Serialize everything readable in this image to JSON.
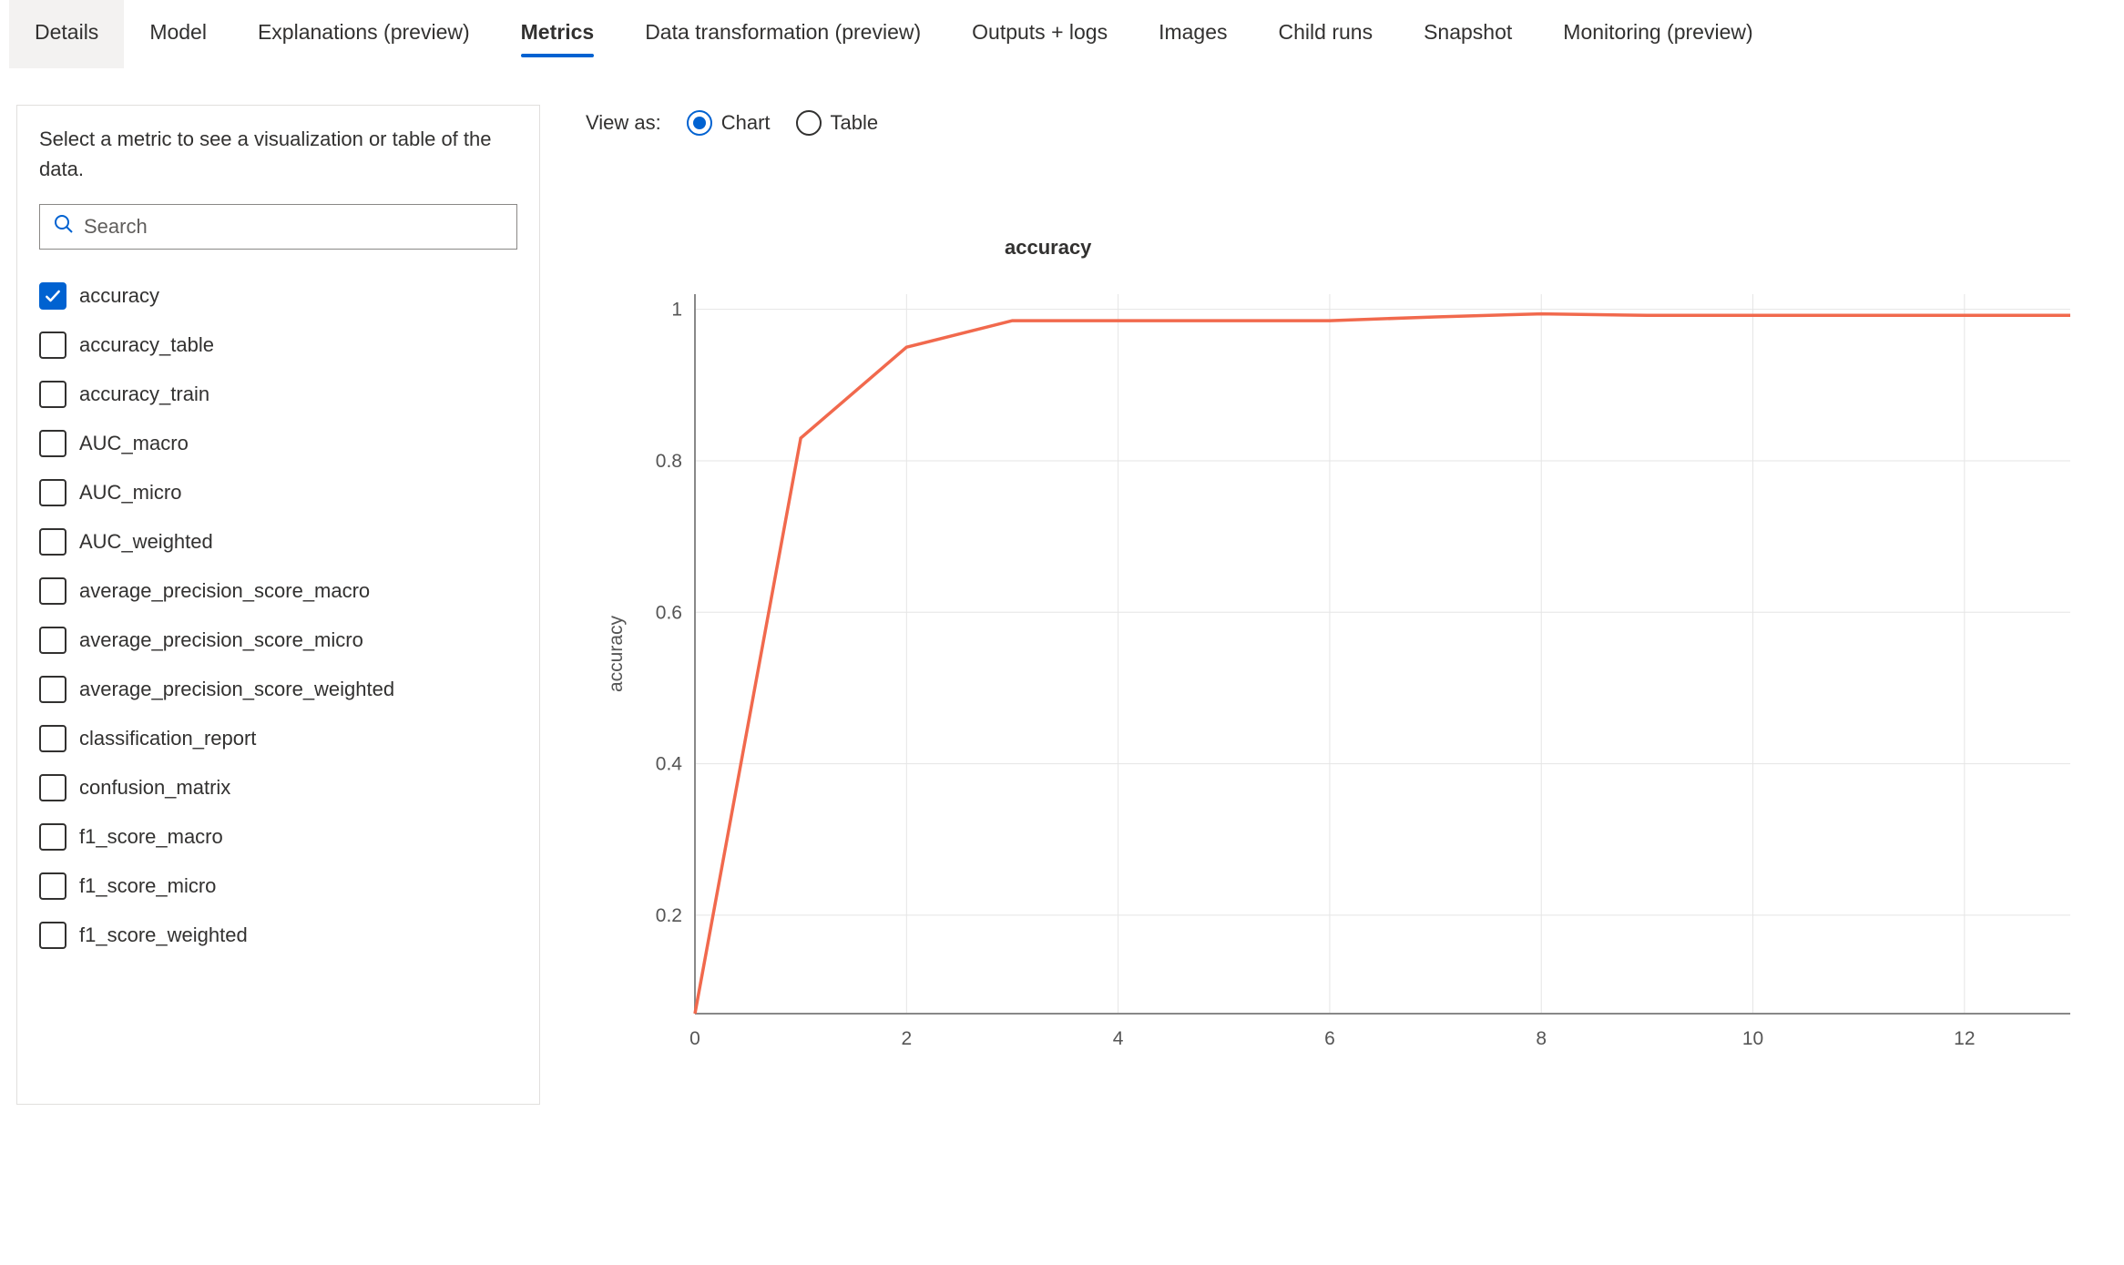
{
  "tabs": [
    {
      "label": "Details",
      "state": "bg"
    },
    {
      "label": "Model",
      "state": ""
    },
    {
      "label": "Explanations (preview)",
      "state": ""
    },
    {
      "label": "Metrics",
      "state": "current"
    },
    {
      "label": "Data transformation (preview)",
      "state": ""
    },
    {
      "label": "Outputs + logs",
      "state": ""
    },
    {
      "label": "Images",
      "state": ""
    },
    {
      "label": "Child runs",
      "state": ""
    },
    {
      "label": "Snapshot",
      "state": ""
    },
    {
      "label": "Monitoring (preview)",
      "state": ""
    }
  ],
  "sidebar": {
    "header": "Select a metric to see a visualization or table of the data.",
    "search_placeholder": "Search"
  },
  "metrics": [
    {
      "label": "accuracy",
      "checked": true
    },
    {
      "label": "accuracy_table",
      "checked": false
    },
    {
      "label": "accuracy_train",
      "checked": false
    },
    {
      "label": "AUC_macro",
      "checked": false
    },
    {
      "label": "AUC_micro",
      "checked": false
    },
    {
      "label": "AUC_weighted",
      "checked": false
    },
    {
      "label": "average_precision_score_macro",
      "checked": false
    },
    {
      "label": "average_precision_score_micro",
      "checked": false
    },
    {
      "label": "average_precision_score_weighted",
      "checked": false
    },
    {
      "label": "classification_report",
      "checked": false
    },
    {
      "label": "confusion_matrix",
      "checked": false
    },
    {
      "label": "f1_score_macro",
      "checked": false
    },
    {
      "label": "f1_score_micro",
      "checked": false
    },
    {
      "label": "f1_score_weighted",
      "checked": false
    }
  ],
  "view_as": {
    "label": "View as:",
    "option_chart": "Chart",
    "option_table": "Table",
    "selected": "chart"
  },
  "chart_data": {
    "type": "line",
    "title": "accuracy",
    "xlabel": "",
    "ylabel": "accuracy",
    "xlim": [
      0,
      13
    ],
    "ylim": [
      0.07,
      1.02
    ],
    "x": [
      0,
      1,
      2,
      3,
      4,
      5,
      6,
      7,
      8,
      9,
      10,
      11,
      12,
      13
    ],
    "y": [
      0.07,
      0.83,
      0.95,
      0.985,
      0.985,
      0.985,
      0.985,
      0.99,
      0.994,
      0.992,
      0.992,
      0.992,
      0.992,
      0.992
    ],
    "xticks": [
      0,
      2,
      4,
      6,
      8,
      10,
      12
    ],
    "yticks": [
      0.2,
      0.4,
      0.6,
      0.8,
      1.0
    ],
    "series_color": "#f1694d"
  }
}
